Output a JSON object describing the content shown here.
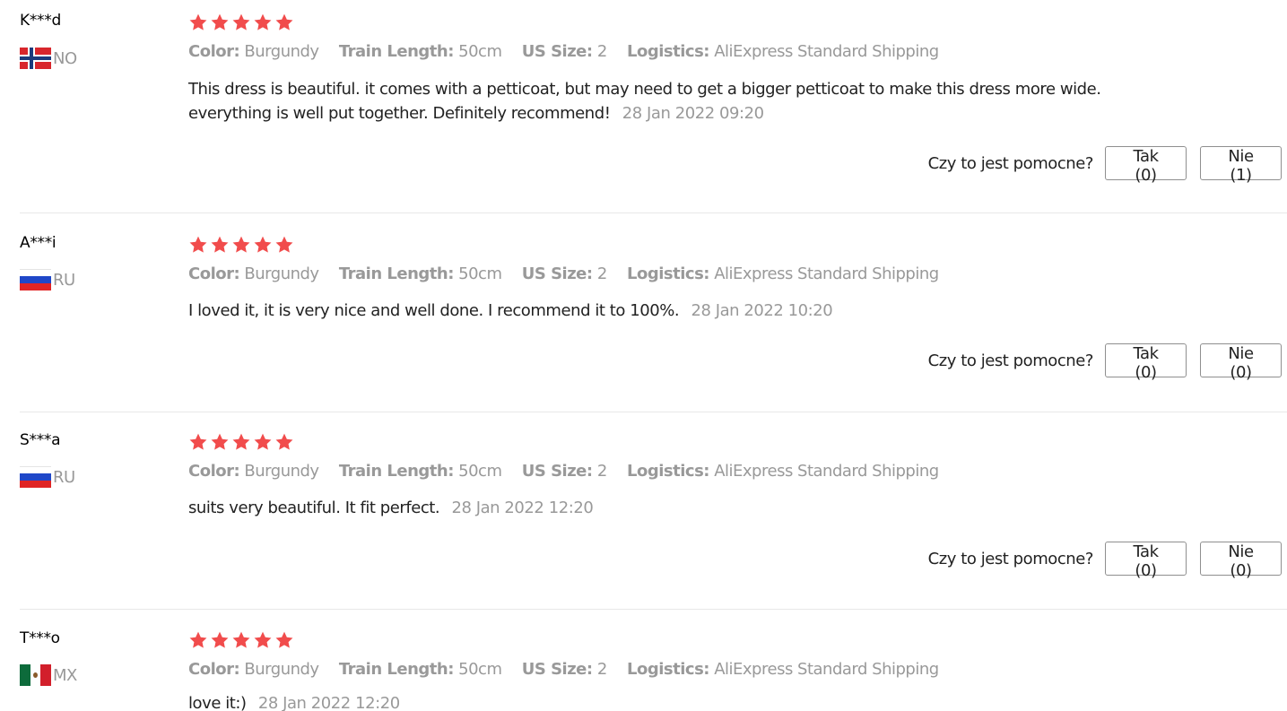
{
  "accent": {
    "star_color": "#f14c4c",
    "muted_text": "#999999",
    "body_text": "#222222"
  },
  "reviews": [
    {
      "user": "K***d",
      "country": "NO",
      "flag_icon": "norway-flag-icon",
      "rating": 5,
      "attributes": [
        {
          "key": "Color:",
          "value": "Burgundy"
        },
        {
          "key": "Train Length:",
          "value": "50cm"
        },
        {
          "key": "US Size:",
          "value": "2"
        },
        {
          "key": "Logistics:",
          "value": "AliExpress Standard Shipping"
        }
      ],
      "text": "This dress is beautiful. it comes with a petticoat, but may need to get a bigger petticoat to make this dress more wide. everything is well put together. Definitely recommend!",
      "date": "28 Jan 2022 09:20",
      "helpful_label": "Czy to jest pomocne?",
      "yes_label": "Tak (0)",
      "no_label": "Nie (1)"
    },
    {
      "user": "A***i",
      "country": "RU",
      "flag_icon": "russia-flag-icon",
      "rating": 5,
      "attributes": [
        {
          "key": "Color:",
          "value": "Burgundy"
        },
        {
          "key": "Train Length:",
          "value": "50cm"
        },
        {
          "key": "US Size:",
          "value": "2"
        },
        {
          "key": "Logistics:",
          "value": "AliExpress Standard Shipping"
        }
      ],
      "text": "I loved it, it is very nice and well done. I recommend it to 100%.",
      "date": "28 Jan 2022 10:20",
      "helpful_label": "Czy to jest pomocne?",
      "yes_label": "Tak (0)",
      "no_label": "Nie (0)"
    },
    {
      "user": "S***a",
      "country": "RU",
      "flag_icon": "russia-flag-icon",
      "rating": 5,
      "attributes": [
        {
          "key": "Color:",
          "value": "Burgundy"
        },
        {
          "key": "Train Length:",
          "value": "50cm"
        },
        {
          "key": "US Size:",
          "value": "2"
        },
        {
          "key": "Logistics:",
          "value": "AliExpress Standard Shipping"
        }
      ],
      "text": "suits very beautiful. It fit perfect.",
      "date": "28 Jan 2022 12:20",
      "helpful_label": "Czy to jest pomocne?",
      "yes_label": "Tak (0)",
      "no_label": "Nie (0)"
    },
    {
      "user": "T***o",
      "country": "MX",
      "flag_icon": "mexico-flag-icon",
      "rating": 5,
      "attributes": [
        {
          "key": "Color:",
          "value": "Burgundy"
        },
        {
          "key": "Train Length:",
          "value": "50cm"
        },
        {
          "key": "US Size:",
          "value": "2"
        },
        {
          "key": "Logistics:",
          "value": "AliExpress Standard Shipping"
        }
      ],
      "text": "love it:)",
      "date": "28 Jan 2022 12:20"
    }
  ]
}
